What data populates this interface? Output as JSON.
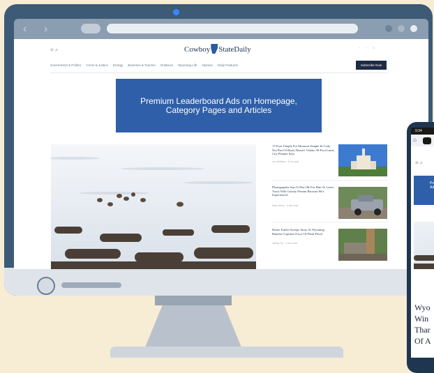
{
  "site": {
    "logo_left": "Cowboy",
    "logo_right": "StateDaily",
    "menu_icons": "≡  ⌕",
    "header_icons": "◦ ◦ ⌂",
    "subscribe_label": "Subscribe Now",
    "nav": [
      "Government & Politics",
      "Crime & Justice",
      "Energy",
      "Business & Tourism",
      "Outdoors",
      "Wyoming Life",
      "Opinion",
      "Daily Features"
    ]
  },
  "ad": {
    "text": "Premium Leaderboard Ads on Homepage, Category Pages and Articles"
  },
  "stories": [
    {
      "title": "17-Foot Temple For Mormon Temple In Cody Not Part Of Road, Doesn't Violate 30-Foot Limit, City Planner Says",
      "meta": "Leo Wolfson  ·  3 hrs read"
    },
    {
      "title": "Photographer Says It Was OK For Him To Leave Truck With Grizzly Present Because He's Experienced",
      "meta": "Mark Heinz  ·  4 min read"
    },
    {
      "title": "Home Trailer Sweeps Away As Wyoming Rancher Captures Force Of Flash Flood",
      "meta": "Jimmy Orr  ·  2 min read"
    }
  ],
  "phone": {
    "time": "9:34",
    "ad_text": "Premium Ads",
    "headline_lines": [
      "Wyo",
      "Win",
      "Thar",
      "Of A"
    ]
  },
  "colors": {
    "background": "#f7ecd4",
    "monitor": "#3d5a76",
    "ad_blue": "#2f5fa8",
    "subscribe": "#1f2b45"
  }
}
